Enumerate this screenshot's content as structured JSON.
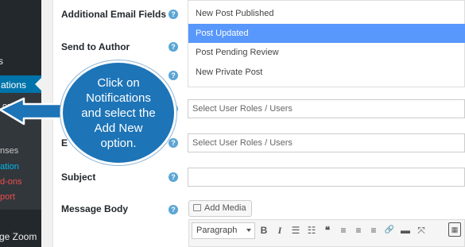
{
  "colors": {
    "sidebar": "#23282d",
    "active": "#0073aa",
    "selected_option": "#5897fb",
    "help": "#5aa5d4",
    "callout": "#1d74b7"
  },
  "sidebar": {
    "items": [
      {
        "label": "s"
      },
      {
        "label": "ations",
        "active": true
      },
      {
        "label": "ons"
      },
      {
        "label": "nses"
      },
      {
        "label": "ation"
      },
      {
        "label": "d-ons"
      },
      {
        "label": "port"
      },
      {
        "label": "ge Zoom"
      }
    ]
  },
  "form": {
    "additional_email_label": "Additional Email Fields",
    "send_to_author_label": "Send to Author",
    "email_label_partial": "E",
    "subject_label": "Subject",
    "message_body_label": "Message Body",
    "help_glyph": "?",
    "options": [
      {
        "label": "New Post Published",
        "selected": false
      },
      {
        "label": "Post Updated",
        "selected": true
      },
      {
        "label": "Post Pending Review",
        "selected": false
      },
      {
        "label": "New Private Post",
        "selected": false
      }
    ],
    "roles_placeholder_1": "Select User Roles / Users",
    "roles_placeholder_2": "Select User Roles / Users",
    "subject_value": "",
    "add_media_label": "Add Media",
    "format_select": "Paragraph",
    "toolbar": {
      "bold": "B",
      "italic": "I",
      "bullets": "☰",
      "numbers": "☷",
      "quote": "❝",
      "align_left": "≡",
      "align_center": "≡",
      "align_right": "≡",
      "link": "🔗",
      "more": "▬",
      "fullscreen": "⤧",
      "kitchen_sink": "▦"
    }
  },
  "callout": {
    "lines": [
      "Click on",
      "Notifications",
      "and select the",
      "Add New",
      "option."
    ]
  }
}
